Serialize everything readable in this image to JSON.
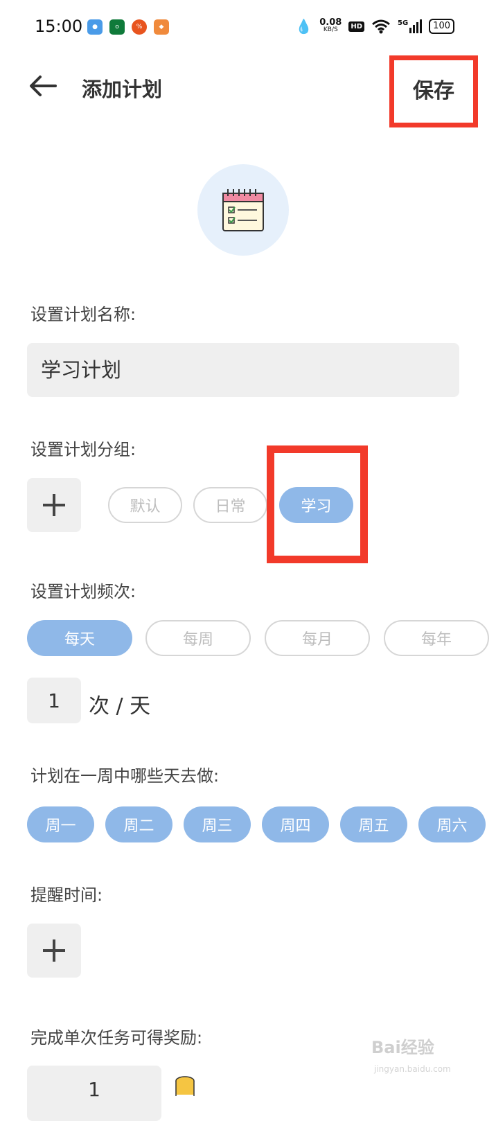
{
  "status_bar": {
    "time": "15:00",
    "net_speed": "0.08",
    "net_unit": "KB/S",
    "hd": "HD",
    "signal": "5G",
    "battery": "100"
  },
  "header": {
    "title": "添加计划",
    "save_label": "保存"
  },
  "form": {
    "name_label": "设置计划名称:",
    "name_value": "学习计划",
    "group_label": "设置计划分组:",
    "groups": [
      {
        "label": "默认",
        "selected": false
      },
      {
        "label": "日常",
        "selected": false
      },
      {
        "label": "学习",
        "selected": true
      }
    ],
    "frequency_label": "设置计划频次:",
    "frequencies": [
      {
        "label": "每天",
        "selected": true
      },
      {
        "label": "每周",
        "selected": false
      },
      {
        "label": "每月",
        "selected": false
      },
      {
        "label": "每年",
        "selected": false
      }
    ],
    "count_value": "1",
    "count_unit": "次 / 天",
    "weekdays_label": "计划在一周中哪些天去做:",
    "weekdays": [
      {
        "label": "周一",
        "selected": true
      },
      {
        "label": "周二",
        "selected": true
      },
      {
        "label": "周三",
        "selected": true
      },
      {
        "label": "周四",
        "selected": true
      },
      {
        "label": "周五",
        "selected": true
      },
      {
        "label": "周六",
        "selected": true
      }
    ],
    "reminder_label": "提醒时间:",
    "reward_label": "完成单次任务可得奖励:",
    "reward_value": "1"
  },
  "watermark": {
    "text": "Bai经验",
    "sub": "jingyan.baidu.com"
  },
  "colors": {
    "accent": "#8fb8e8",
    "highlight": "#f23a2a",
    "field_bg": "#efefef"
  }
}
